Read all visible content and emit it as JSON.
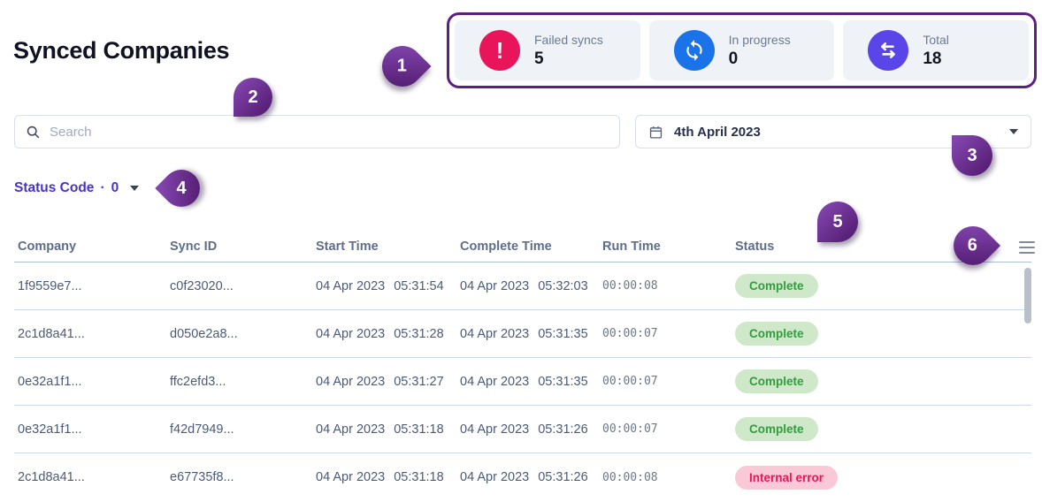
{
  "page": {
    "title": "Synced Companies"
  },
  "stats": {
    "cards": [
      {
        "label": "Failed syncs",
        "value": "5",
        "icon": "alert-circle-icon",
        "icon_bg": "#e8155a"
      },
      {
        "label": "In progress",
        "value": "0",
        "icon": "sync-icon",
        "icon_bg": "#1a73e8"
      },
      {
        "label": "Total",
        "value": "18",
        "icon": "transfer-arrows-icon",
        "icon_bg": "#5a45e8"
      }
    ]
  },
  "search": {
    "placeholder": "Search"
  },
  "date_filter": {
    "value": "4th April 2023"
  },
  "status_filter": {
    "label": "Status Code",
    "dot": "·",
    "count": "0"
  },
  "table": {
    "columns": [
      "Company",
      "Sync ID",
      "Start Time",
      "Complete Time",
      "Run Time",
      "Status"
    ],
    "rows": [
      {
        "company": "1f9559e7...",
        "sync_id": "c0f23020...",
        "start_date": "04 Apr 2023",
        "start_time": "05:31:54",
        "complete_date": "04 Apr 2023",
        "complete_time": "05:32:03",
        "run_time": "00:00:08",
        "status": "Complete",
        "status_type": "success"
      },
      {
        "company": "2c1d8a41...",
        "sync_id": "d050e2a8...",
        "start_date": "04 Apr 2023",
        "start_time": "05:31:28",
        "complete_date": "04 Apr 2023",
        "complete_time": "05:31:35",
        "run_time": "00:00:07",
        "status": "Complete",
        "status_type": "success"
      },
      {
        "company": "0e32a1f1...",
        "sync_id": "ffc2efd3...",
        "start_date": "04 Apr 2023",
        "start_time": "05:31:27",
        "complete_date": "04 Apr 2023",
        "complete_time": "05:31:35",
        "run_time": "00:00:07",
        "status": "Complete",
        "status_type": "success"
      },
      {
        "company": "0e32a1f1...",
        "sync_id": "f42d7949...",
        "start_date": "04 Apr 2023",
        "start_time": "05:31:18",
        "complete_date": "04 Apr 2023",
        "complete_time": "05:31:26",
        "run_time": "00:00:07",
        "status": "Complete",
        "status_type": "success"
      },
      {
        "company": "2c1d8a41...",
        "sync_id": "e67735f8...",
        "start_date": "04 Apr 2023",
        "start_time": "05:31:18",
        "complete_date": "04 Apr 2023",
        "complete_time": "05:31:26",
        "run_time": "00:00:08",
        "status": "Internal error",
        "status_type": "error"
      }
    ]
  },
  "annotations": [
    {
      "label": "1"
    },
    {
      "label": "2"
    },
    {
      "label": "3"
    },
    {
      "label": "4"
    },
    {
      "label": "5"
    },
    {
      "label": "6"
    }
  ],
  "colors": {
    "annotation_purple": "#5c2080",
    "failed_icon": "#e8155a",
    "in_progress_icon": "#1a73e8",
    "total_icon": "#5a45e8",
    "status_filter_text": "#4633cf",
    "success_badge_bg": "#cfe8c9",
    "success_badge_text": "#2f9e3c",
    "error_badge_bg": "#fac9d7",
    "error_badge_text": "#ee1556",
    "card_bg": "#eff3f8"
  }
}
